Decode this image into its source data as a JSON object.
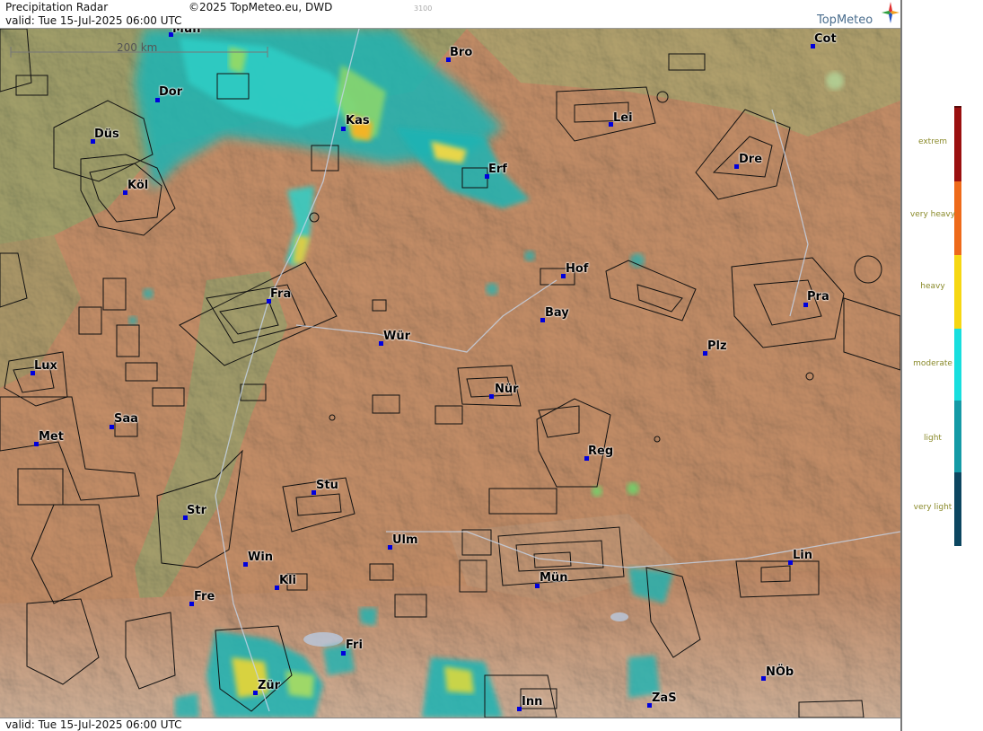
{
  "header": {
    "title": "Precipitation Radar",
    "valid": "valid:  Tue  15-Jul-2025 06:00 UTC",
    "copyright": "©2025 TopMeteo.eu, DWD",
    "code": "3100",
    "brand": "TopMeteo"
  },
  "footer": {
    "valid": "valid:  Tue  15-Jul-2025 06:00 UTC"
  },
  "scale": {
    "label": "200 km"
  },
  "legend": {
    "labels": [
      "extrem",
      "very heavy",
      "heavy",
      "moderate",
      "light",
      "very light"
    ],
    "colors": [
      "#9a1010",
      "#ee6a1a",
      "#f6d713",
      "#18dede",
      "#159aa6",
      "#0c4660"
    ]
  },
  "cities": [
    {
      "id": "mun-top",
      "name": "Mün"
    },
    {
      "id": "bro",
      "name": "Bro"
    },
    {
      "id": "cot",
      "name": "Cot"
    },
    {
      "id": "dor",
      "name": "Dor"
    },
    {
      "id": "kas",
      "name": "Kas"
    },
    {
      "id": "lei",
      "name": "Lei"
    },
    {
      "id": "dus",
      "name": "Düs"
    },
    {
      "id": "dre",
      "name": "Dre"
    },
    {
      "id": "erf",
      "name": "Erf"
    },
    {
      "id": "kol",
      "name": "Köl"
    },
    {
      "id": "hof",
      "name": "Hof"
    },
    {
      "id": "fra",
      "name": "Fra"
    },
    {
      "id": "pra",
      "name": "Pra"
    },
    {
      "id": "bay",
      "name": "Bay"
    },
    {
      "id": "wur",
      "name": "Wür"
    },
    {
      "id": "plz",
      "name": "Plz"
    },
    {
      "id": "lux",
      "name": "Lux"
    },
    {
      "id": "nur",
      "name": "Nür"
    },
    {
      "id": "saa",
      "name": "Saa"
    },
    {
      "id": "met",
      "name": "Met"
    },
    {
      "id": "reg",
      "name": "Reg"
    },
    {
      "id": "stu",
      "name": "Stu"
    },
    {
      "id": "str",
      "name": "Str"
    },
    {
      "id": "ulm",
      "name": "Ulm"
    },
    {
      "id": "win",
      "name": "Win"
    },
    {
      "id": "lin",
      "name": "Lin"
    },
    {
      "id": "kli",
      "name": "Kli"
    },
    {
      "id": "mun",
      "name": "Mün"
    },
    {
      "id": "fre",
      "name": "Fre"
    },
    {
      "id": "fri",
      "name": "Fri"
    },
    {
      "id": "nob",
      "name": "NÖb"
    },
    {
      "id": "zur",
      "name": "Zür"
    },
    {
      "id": "inn",
      "name": "Inn"
    },
    {
      "id": "zas",
      "name": "ZaS"
    }
  ]
}
